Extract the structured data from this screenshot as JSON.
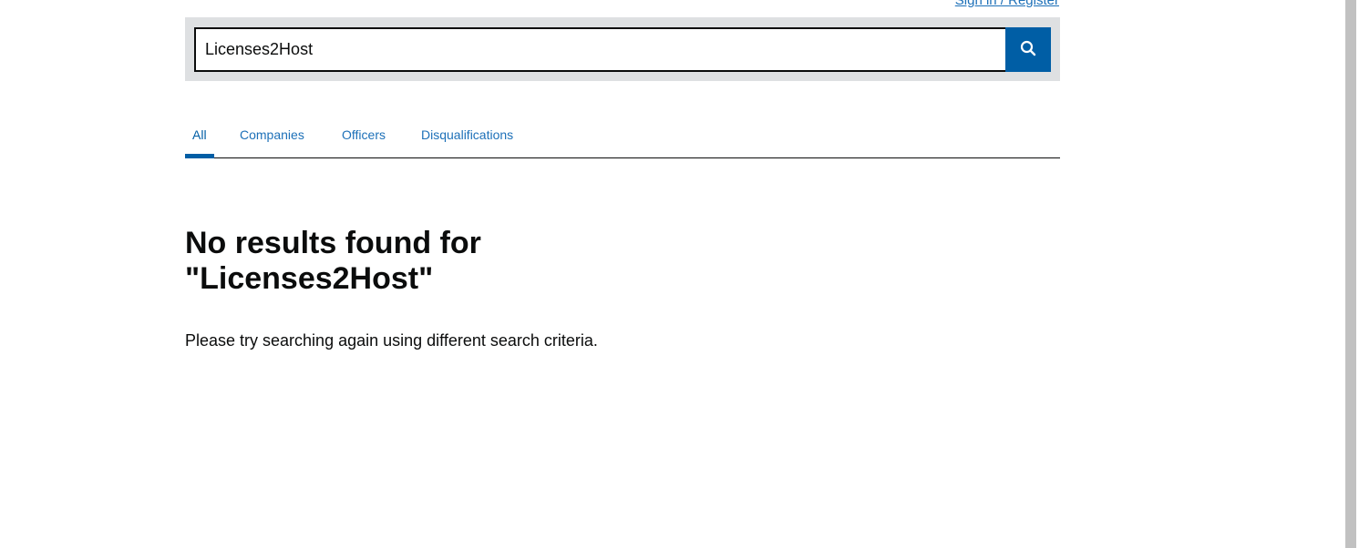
{
  "header": {
    "signin_label": "Sign in / Register"
  },
  "search": {
    "value": "Licenses2Host",
    "button_icon": "search-icon"
  },
  "tabs": [
    {
      "label": "All",
      "active": true
    },
    {
      "label": "Companies",
      "active": false
    },
    {
      "label": "Officers",
      "active": false
    },
    {
      "label": "Disqualifications",
      "active": false
    }
  ],
  "results": {
    "heading_line1": "No results found for",
    "heading_line2": "\"Licenses2Host\"",
    "hint": "Please try searching again using different search criteria."
  },
  "colors": {
    "accent": "#005ea5",
    "link": "#1d70b8",
    "panel": "#dee0e2"
  }
}
